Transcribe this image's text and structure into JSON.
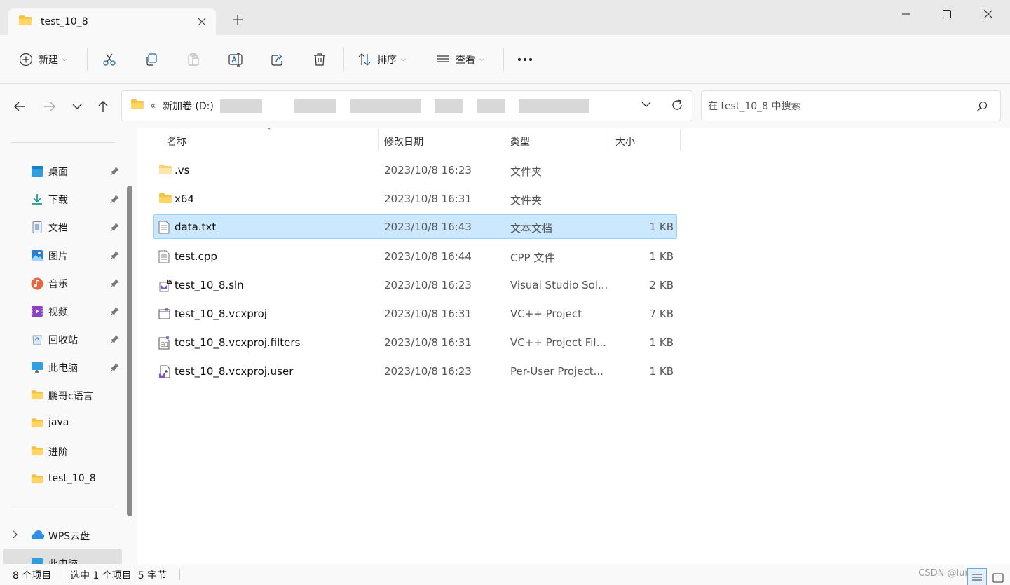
{
  "window": {
    "tab_title": "test_10_8",
    "icons": {
      "close": "close-icon",
      "new_tab": "plus-icon",
      "minimize": "minimize-icon",
      "maximize": "maximize-icon",
      "window_close": "window-close-icon"
    }
  },
  "toolbar": {
    "new_label": "新建",
    "sort_label": "排序",
    "view_label": "查看",
    "icons": [
      "cut-icon",
      "copy-icon",
      "paste-icon",
      "rename-icon",
      "share-icon",
      "delete-icon",
      "more-icon"
    ]
  },
  "address": {
    "path_root": "新加卷 (D:)",
    "overflow": "«"
  },
  "search": {
    "placeholder": "在 test_10_8 中搜索"
  },
  "sidebar": {
    "quick_access": [
      {
        "label": "桌面",
        "icon": "desktop-icon",
        "pinned": true
      },
      {
        "label": "下载",
        "icon": "download-icon",
        "pinned": true
      },
      {
        "label": "文档",
        "icon": "document-icon",
        "pinned": true
      },
      {
        "label": "图片",
        "icon": "pictures-icon",
        "pinned": true
      },
      {
        "label": "音乐",
        "icon": "music-icon",
        "pinned": true
      },
      {
        "label": "视频",
        "icon": "video-icon",
        "pinned": true
      },
      {
        "label": "回收站",
        "icon": "recycle-bin-icon",
        "pinned": true
      },
      {
        "label": "此电脑",
        "icon": "computer-icon",
        "pinned": true
      },
      {
        "label": "鹏哥c语言",
        "icon": "folder-icon",
        "pinned": false
      },
      {
        "label": "java",
        "icon": "folder-icon",
        "pinned": false
      },
      {
        "label": "进阶",
        "icon": "folder-icon",
        "pinned": false
      },
      {
        "label": "test_10_8",
        "icon": "folder-icon",
        "pinned": false
      }
    ],
    "bottom": [
      {
        "label": "WPS云盘",
        "icon": "cloud-icon"
      },
      {
        "label": "此电脑",
        "icon": "computer-icon"
      }
    ]
  },
  "columns": {
    "name": "名称",
    "date": "修改日期",
    "type": "类型",
    "size": "大小"
  },
  "files": [
    {
      "name": ".vs",
      "date": "2023/10/8 16:23",
      "type": "文件夹",
      "size": "",
      "icon": "folder-icon",
      "selected": false
    },
    {
      "name": "x64",
      "date": "2023/10/8 16:31",
      "type": "文件夹",
      "size": "",
      "icon": "folder-icon",
      "selected": false
    },
    {
      "name": "data.txt",
      "date": "2023/10/8 16:43",
      "type": "文本文档",
      "size": "1 KB",
      "icon": "text-file-icon",
      "selected": true
    },
    {
      "name": "test.cpp",
      "date": "2023/10/8 16:44",
      "type": "CPP 文件",
      "size": "1 KB",
      "icon": "text-file-icon",
      "selected": false
    },
    {
      "name": "test_10_8.sln",
      "date": "2023/10/8 16:23",
      "type": "Visual Studio Sol...",
      "size": "2 KB",
      "icon": "solution-file-icon",
      "selected": false
    },
    {
      "name": "test_10_8.vcxproj",
      "date": "2023/10/8 16:31",
      "type": "VC++ Project",
      "size": "7 KB",
      "icon": "vcxproj-file-icon",
      "selected": false
    },
    {
      "name": "test_10_8.vcxproj.filters",
      "date": "2023/10/8 16:31",
      "type": "VC++ Project Fil...",
      "size": "1 KB",
      "icon": "filters-file-icon",
      "selected": false
    },
    {
      "name": "test_10_8.vcxproj.user",
      "date": "2023/10/8 16:23",
      "type": "Per-User Project...",
      "size": "1 KB",
      "icon": "user-file-icon",
      "selected": false
    }
  ],
  "status": {
    "count": "8 个项目",
    "selection": "选中 1 个项目  5 字节",
    "watermark": "CSDN @lumi..."
  }
}
